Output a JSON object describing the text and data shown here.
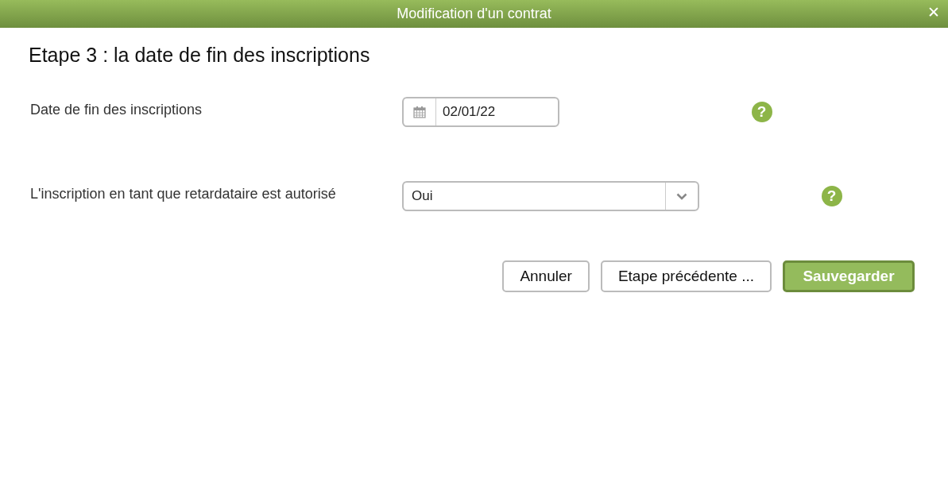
{
  "window": {
    "title": "Modification d'un contrat",
    "close": "✕"
  },
  "heading": "Etape 3 : la date de fin des inscriptions",
  "fields": [
    {
      "kind": "date",
      "label": "Date de fin des inscriptions",
      "value": "02/01/22",
      "help": "?"
    },
    {
      "kind": "select",
      "label": "L'inscription en tant que retardataire est autorisé",
      "value": "Oui",
      "help": "?"
    }
  ],
  "buttons": [
    {
      "kind": "default",
      "label": "Annuler"
    },
    {
      "kind": "default",
      "label": "Etape précédente ..."
    },
    {
      "kind": "primary",
      "label": "Sauvegarder"
    }
  ]
}
